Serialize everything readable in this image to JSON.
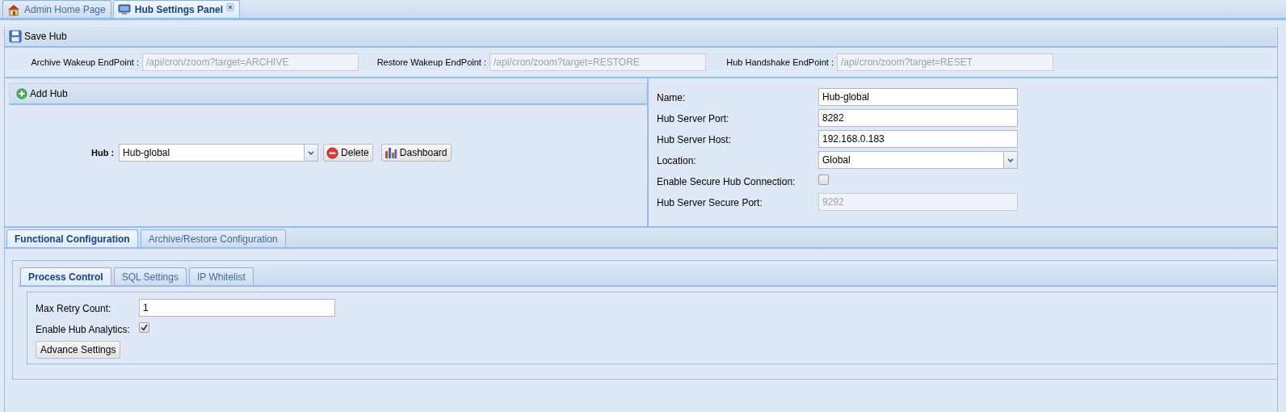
{
  "tabs": [
    {
      "label": "Admin Home Page",
      "selected": false,
      "closable": false
    },
    {
      "label": "Hub Settings Panel",
      "selected": true,
      "closable": true
    }
  ],
  "toolbar": {
    "save_button": "Save Hub"
  },
  "endpoints": [
    {
      "label": "Archive Wakeup EndPoint :",
      "value": "/api/cron/zoom?target=ARCHIVE",
      "disabled": true
    },
    {
      "label": "Restore Wakeup EndPoint :",
      "value": "/api/cron/zoom?target=RESTORE",
      "disabled": true
    },
    {
      "label": "Hub Handshake EndPoint :",
      "value": "/api/cron/zoom?target=RESET",
      "disabled": true
    }
  ],
  "hub_panel": {
    "add_button": "Add Hub",
    "hub_label": "Hub :",
    "hub_value": "Hub-global",
    "delete_button": "Delete",
    "dashboard_button": "Dashboard"
  },
  "hub_form": [
    {
      "kind": "text",
      "label": "Name:",
      "value": "Hub-global",
      "disabled": false
    },
    {
      "kind": "text",
      "label": "Hub Server Port:",
      "value": "8282",
      "disabled": false
    },
    {
      "kind": "text",
      "label": "Hub Server Host:",
      "value": "192.168.0.183",
      "disabled": false
    },
    {
      "kind": "select",
      "label": "Location:",
      "value": "Global",
      "disabled": false
    },
    {
      "kind": "checkbox",
      "label": "Enable Secure Hub Connection:",
      "checked": false
    },
    {
      "kind": "text",
      "label": "Hub Server Secure Port:",
      "value": "9292",
      "disabled": true
    }
  ],
  "config_tabs": [
    {
      "label": "Functional Configuration",
      "selected": true
    },
    {
      "label": "Archive/Restore Configuration",
      "selected": false
    }
  ],
  "process_tabs": [
    {
      "label": "Process Control",
      "selected": true
    },
    {
      "label": "SQL Settings",
      "selected": false
    },
    {
      "label": "IP Whitelist",
      "selected": false
    }
  ],
  "process_form": [
    {
      "kind": "text",
      "label": "Max Retry Count:",
      "value": "1",
      "disabled": false
    },
    {
      "kind": "checkbox",
      "label": "Enable Hub Analytics:",
      "checked": true
    }
  ],
  "advance_button": "Advance Settings"
}
